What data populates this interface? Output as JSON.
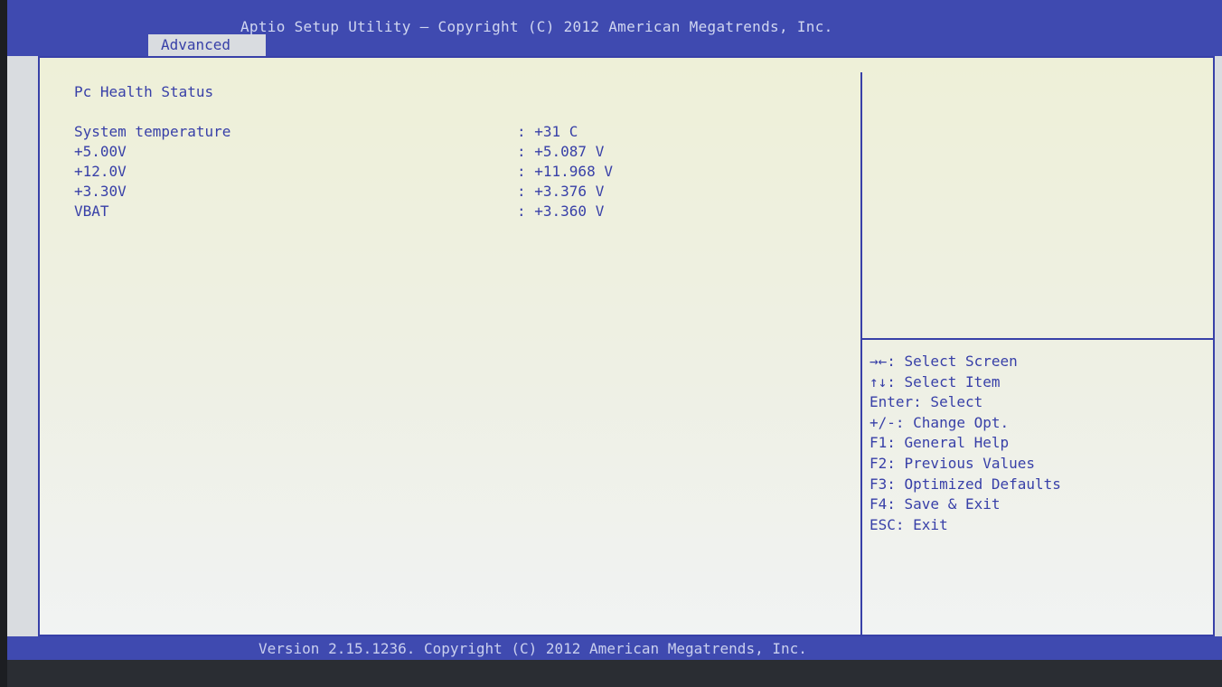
{
  "header": {
    "title": "Aptio Setup Utility – Copyright (C) 2012 American Megatrends, Inc.",
    "active_tab": "Advanced"
  },
  "main": {
    "section_title": "Pc Health Status",
    "rows": [
      {
        "label": "System temperature",
        "value": ": +31 C"
      },
      {
        "label": "+5.00V",
        "value": ": +5.087 V"
      },
      {
        "label": "+12.0V",
        "value": ": +11.968 V"
      },
      {
        "label": "+3.30V",
        "value": ": +3.376 V"
      },
      {
        "label": "VBAT",
        "value": ": +3.360 V"
      }
    ]
  },
  "help": {
    "items": [
      "→←: Select Screen",
      "↑↓: Select Item",
      "Enter: Select",
      "+/-: Change Opt.",
      "F1: General Help",
      "F2: Previous Values",
      "F3: Optimized Defaults",
      "F4: Save & Exit",
      "ESC: Exit"
    ]
  },
  "footer": {
    "text": "Version 2.15.1236. Copyright (C) 2012 American Megatrends, Inc."
  },
  "colors": {
    "accent": "#3840a8",
    "header_bg": "#3f4ab0",
    "panel_bg": "#eef0e4"
  }
}
